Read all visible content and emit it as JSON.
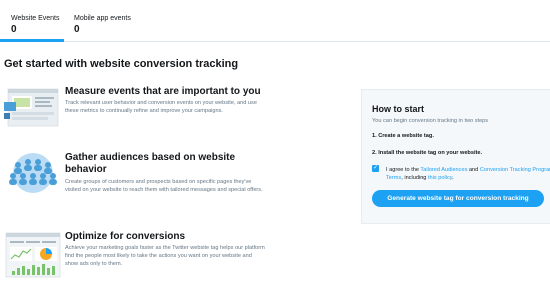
{
  "tabs": [
    {
      "label": "Website Events",
      "count": "0"
    },
    {
      "label": "Mobile app events",
      "count": "0"
    }
  ],
  "heading": "Get started with website conversion tracking",
  "features": [
    {
      "title": "Measure events that are important to you",
      "desc": "Track relevant user behavior and conversion events on your website, and use these metrics to continually refine and improve your campaigns."
    },
    {
      "title": "Gather audiences based on website behavior",
      "desc": "Create groups of customers and prospects based on specific pages they've visited on your website to reach them with tailored messages and special offers."
    },
    {
      "title": "Optimize for conversions",
      "desc": "Achieve your marketing goals faster as the Twitter website tag helps our platform find the people most likely to take the actions you want on your website and show ads only to them."
    }
  ],
  "how_to_start": {
    "title": "How to start",
    "subtitle": "You can begin conversion tracking in two steps",
    "step1": "1. Create a website tag.",
    "step2": "2. Install the website tag on your website.",
    "agree_prefix": "I agree to the ",
    "link_audiences": "Tailored Audiences",
    "agree_and": " and ",
    "link_terms": "Conversion Tracking Program Terms",
    "agree_including": ", including ",
    "link_policy": "this policy",
    "agree_end": ".",
    "button": "Generate website tag for conversion tracking"
  },
  "colors": {
    "accent": "#1da1f2",
    "text": "#14171a",
    "muted": "#657786",
    "panel_bg": "#f5f8fa"
  },
  "icons": [
    "browser-illustration",
    "audience-illustration",
    "dashboard-illustration",
    "checkbox-checked-icon"
  ]
}
